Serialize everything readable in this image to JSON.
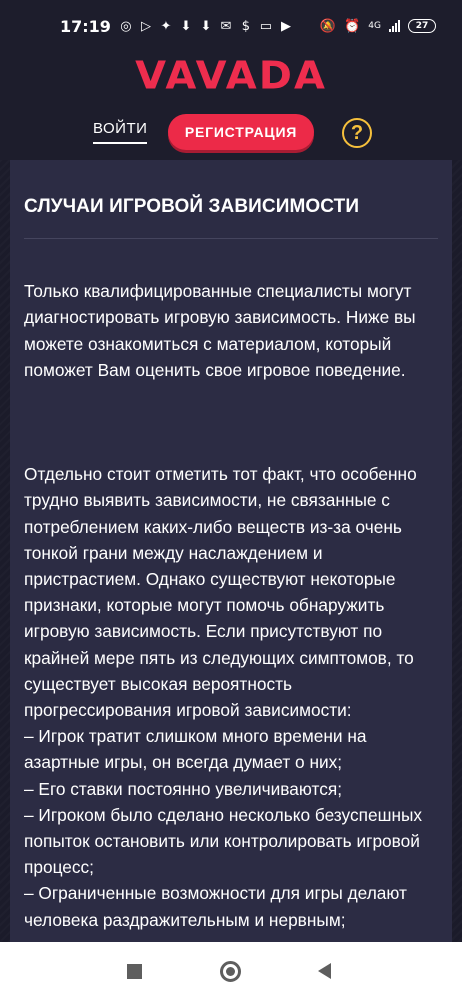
{
  "status_bar": {
    "time": "17:19",
    "left_icons": [
      "whatsapp-icon",
      "play-store-icon",
      "spark-icon",
      "download-icon",
      "download-icon",
      "gmail-icon",
      "cash-icon",
      "message-icon",
      "play-icon"
    ],
    "network": "4G",
    "battery": "27"
  },
  "header": {
    "logo_text": "VAVADA",
    "login_label": "ВОЙТИ",
    "register_label": "РЕГИСТРАЦИЯ",
    "help_label": "?"
  },
  "card": {
    "title": "СЛУЧАИ ИГРОВОЙ ЗАВИСИМОСТИ",
    "paragraphs": [
      "Только квалифицированные специалисты могут диагностировать игровую зависимость. Ниже вы можете ознакомиться с материалом, который поможет Вам оценить свое игровое поведение.",
      "Отдельно стоит отметить тот факт, что особенно трудно выявить зависимости, не связанные с потреблением каких-либо веществ из-за очень тонкой грани между наслаждением и пристрастием. Однако существуют некоторые признаки, которые могут помочь обнаружить игровую зависимость. Если присутствуют по крайней мере пять из следующих симптомов, то существует высокая вероятность прогрессирования игровой зависимости:\n– Игрок тратит слишком много времени на азартные игры, он всегда думает о них;\n– Его ставки постоянно увеличиваются;\n– Игроком было сделано несколько безуспешных попыток остановить или контролировать игровой процесс;\n– Ограниченные возможности для игры делают человека раздражительным и нервным;"
    ]
  },
  "colors": {
    "background": "#1d1d2c",
    "card": "#2c2c44",
    "brand_red": "#ec2a48",
    "help_yellow": "#f6c03c"
  }
}
